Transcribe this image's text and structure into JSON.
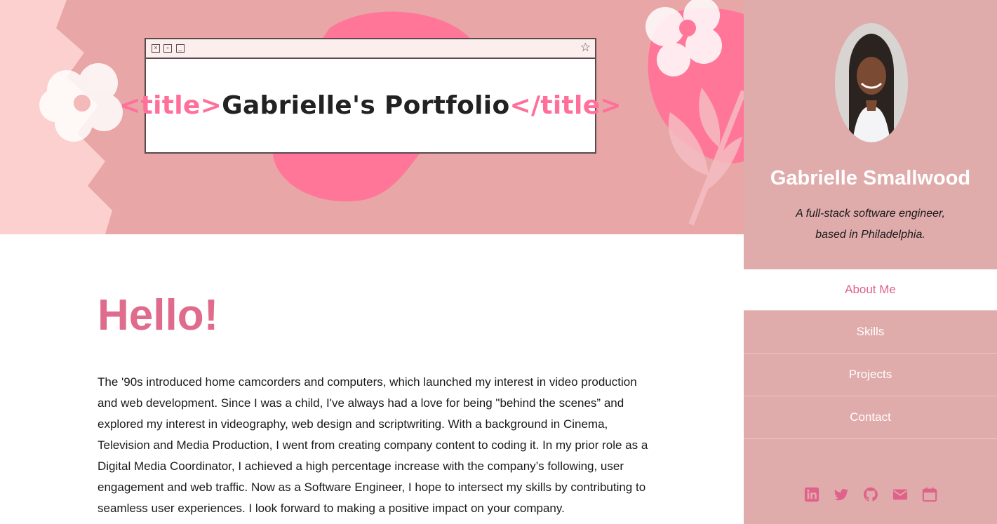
{
  "banner": {
    "logo": {
      "tag_open": "<title>",
      "name": "Gabrielle's Portfolio",
      "tag_close": "</title>"
    },
    "window_controls": [
      "close-icon",
      "maximize-icon",
      "minimize-icon"
    ],
    "bookmark_icon": "star-icon"
  },
  "main": {
    "heading": "Hello!",
    "paragraph": "The '90s introduced home camcorders and computers, which launched my interest in video production and web development. Since I was a child, I've always had a love for being \"behind the scenes” and explored my interest in videography, web design and scriptwriting. With a background in Cinema, Television and Media Production, I went from creating company content to coding it. In my prior role as a Digital Media Coordinator, I achieved a high percentage increase with the company’s following, user engagement and web traffic. Now as a Software Engineer, I hope to intersect my skills by contributing to seamless user experiences. I look forward to making a positive impact on your company."
  },
  "sidebar": {
    "name": "Gabrielle Smallwood",
    "tagline_line1": "A full-stack software engineer,",
    "tagline_line2": "based in Philadelphia.",
    "nav": [
      {
        "label": "About Me",
        "active": true
      },
      {
        "label": "Skills",
        "active": false
      },
      {
        "label": "Projects",
        "active": false
      },
      {
        "label": "Contact",
        "active": false
      }
    ],
    "social_icons": [
      "linkedin-icon",
      "twitter-icon",
      "github-icon",
      "email-icon",
      "calendar-icon"
    ]
  },
  "colors": {
    "banner_bg": "#e8a6a6",
    "accent_pink": "#ff6f9a",
    "heading_pink": "#df6c8c",
    "sidebar_bg": "#e0abab",
    "icon_pink": "#e0618a"
  }
}
